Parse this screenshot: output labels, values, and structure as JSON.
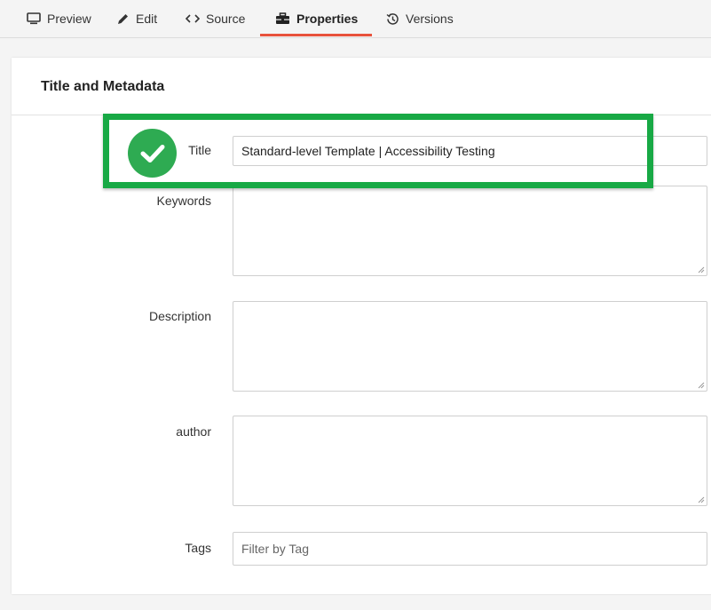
{
  "tabs": [
    {
      "label": "Preview",
      "icon": "monitor-icon"
    },
    {
      "label": "Edit",
      "icon": "pencil-icon"
    },
    {
      "label": "Source",
      "icon": "code-icon"
    },
    {
      "label": "Properties",
      "icon": "toolbox-icon",
      "active": true
    },
    {
      "label": "Versions",
      "icon": "history-icon"
    }
  ],
  "card": {
    "title": "Title and Metadata"
  },
  "fields": {
    "title": {
      "label": "Title",
      "value": "Standard-level Template | Accessibility Testing"
    },
    "keywords": {
      "label": "Keywords",
      "value": ""
    },
    "description": {
      "label": "Description",
      "value": ""
    },
    "author": {
      "label": "author",
      "value": ""
    },
    "tags": {
      "label": "Tags",
      "placeholder": "Filter by Tag"
    }
  },
  "annotation": {
    "highlight_color": "#18a945",
    "check_color": "#2eab52",
    "icon": "checkmark-icon"
  },
  "colors": {
    "tab_underline": "#e8523c"
  }
}
